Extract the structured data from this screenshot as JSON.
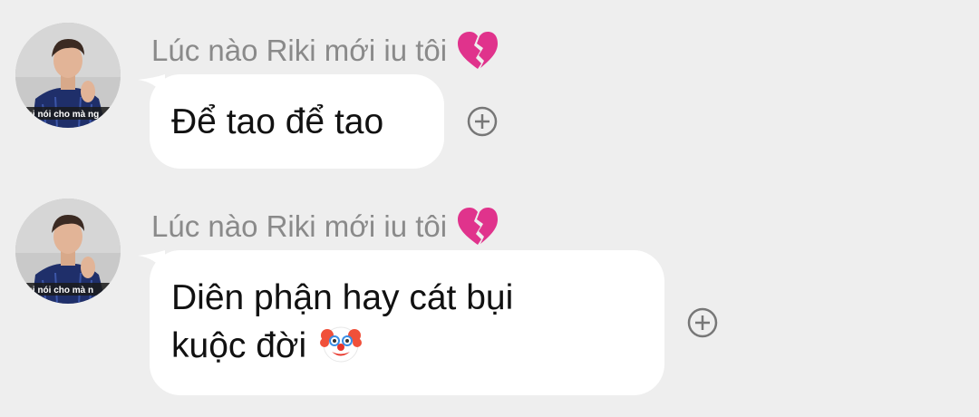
{
  "messages": [
    {
      "sender": "Lúc nào Riki mới iu tôi",
      "sender_emoji": "broken-heart-icon",
      "avatar_caption": "mi nói cho mà ng",
      "text": "Để tao để tao",
      "text_emoji": ""
    },
    {
      "sender": "Lúc nào Riki mới iu tôi",
      "sender_emoji": "broken-heart-icon",
      "avatar_caption": "mi nói cho mà n",
      "text_line1": "Diên phận hay cát bụi",
      "text_line2": "kuộc đời",
      "text_emoji": "clown-face-icon"
    }
  ],
  "colors": {
    "background": "#eeeeee",
    "bubble": "#ffffff",
    "sender_text": "#8a8a8a",
    "message_text": "#111111",
    "heart": "#e0338c",
    "icon_gray": "#777777"
  }
}
